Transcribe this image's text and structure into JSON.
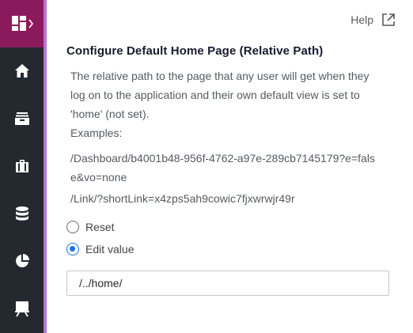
{
  "help": {
    "label": "Help"
  },
  "section": {
    "title": "Configure Default Home Page (Relative Path)",
    "description": "The relative path to the page that any user will get when they log on to the application and their own default view is set to 'home' (not set).",
    "examples_label": "Examples:",
    "examples": [
      "/Dashboard/b4001b48-956f-4762-a97e-289cb7145179?e=false&vo=none",
      "/Link/?shortLink=x4zps5ah9cowic7fjxwrwjr49r"
    ]
  },
  "options": [
    {
      "label": "Reset",
      "checked": false
    },
    {
      "label": "Edit value",
      "checked": true
    }
  ],
  "value_input": {
    "value": "/../home/"
  },
  "sidebar": {
    "icons": [
      "dashboard-icon",
      "home-icon",
      "inbox-icon",
      "briefcase-icon",
      "database-icon",
      "pie-chart-icon",
      "presentation-icon"
    ]
  },
  "colors": {
    "brand": "#8b1a5c",
    "sidebar": "#24292f",
    "accent": "#b576d6",
    "radio": "#1a73e8"
  }
}
